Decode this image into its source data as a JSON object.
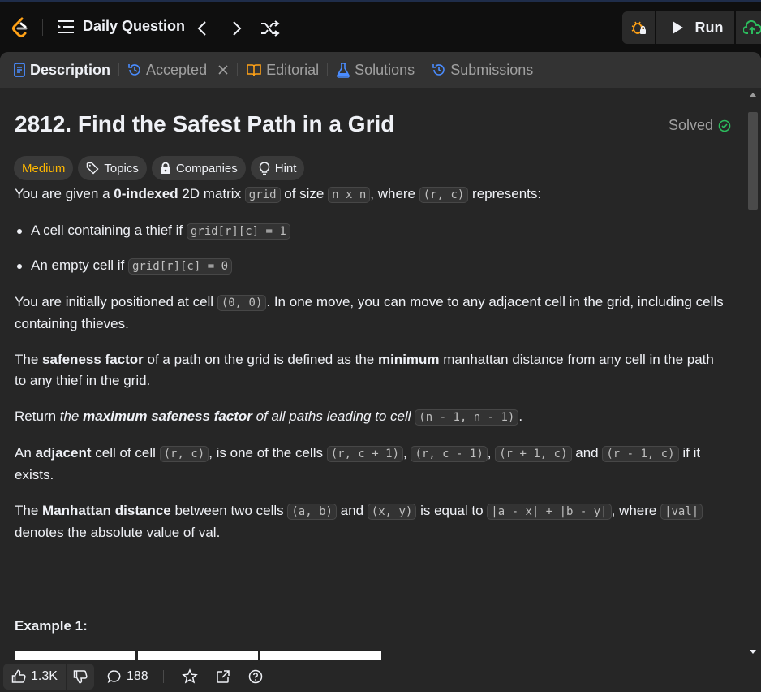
{
  "topbar": {
    "daily_question_label": "Daily Question",
    "run_label": "Run"
  },
  "tabs": [
    {
      "label": "Description",
      "active": true
    },
    {
      "label": "Accepted",
      "active": false
    },
    {
      "label": "Editorial",
      "active": false
    },
    {
      "label": "Solutions",
      "active": false
    },
    {
      "label": "Submissions",
      "active": false
    }
  ],
  "problem": {
    "title": "2812. Find the Safest Path in a Grid",
    "status": "Solved",
    "difficulty": "Medium",
    "tags": [
      "Topics",
      "Companies",
      "Hint"
    ]
  },
  "description": {
    "p1": {
      "a": "You are given a ",
      "b": "0-indexed",
      "c": " 2D matrix ",
      "code1": "grid",
      "d": " of size ",
      "code2": "n x n",
      "e": ", where ",
      "code3": "(r, c)",
      "f": " represents:"
    },
    "li1": {
      "text": "A cell containing a thief if ",
      "code": "grid[r][c] = 1"
    },
    "li2": {
      "text": "An empty cell if ",
      "code": "grid[r][c] = 0"
    },
    "p2": {
      "a": "You are initially positioned at cell ",
      "code": "(0, 0)",
      "b": ". In one move, you can move to any adjacent cell in the grid, including cells containing thieves."
    },
    "p3": {
      "a": "The ",
      "b": "safeness factor",
      "c": " of a path on the grid is defined as the ",
      "d": "minimum",
      "e": " manhattan distance from any cell in the path to any thief in the grid."
    },
    "p4": {
      "a": "Return ",
      "b": "the ",
      "c": "maximum safeness factor",
      "d": " of all paths leading to cell ",
      "code": "(n - 1, n - 1)",
      "e": "."
    },
    "p5": {
      "a": "An ",
      "b": "adjacent",
      "c": " cell of cell ",
      "code1": "(r, c)",
      "d": ", is one of the cells ",
      "code2": "(r, c + 1)",
      "e": ", ",
      "code3": "(r, c - 1)",
      "f": ", ",
      "code4": "(r + 1, c)",
      "g": " and ",
      "code5": "(r - 1, c)",
      "h": " if it exists."
    },
    "p6": {
      "a": "The ",
      "b": "Manhattan distance",
      "c": " between two cells ",
      "code1": "(a, b)",
      "d": " and ",
      "code2": "(x, y)",
      "e": " is equal to ",
      "code3": "|a - x| + |b - y|",
      "f": ", where ",
      "code4": "|val|",
      "g": " denotes the absolute value of val."
    },
    "example_heading": "Example 1:"
  },
  "footer": {
    "likes": "1.3K",
    "comments": "188"
  },
  "colors": {
    "accent_orange": "#ffa116",
    "medium": "#ffb800",
    "solved_green": "#2cbb5d",
    "tab_blue": "#4a8cff"
  }
}
